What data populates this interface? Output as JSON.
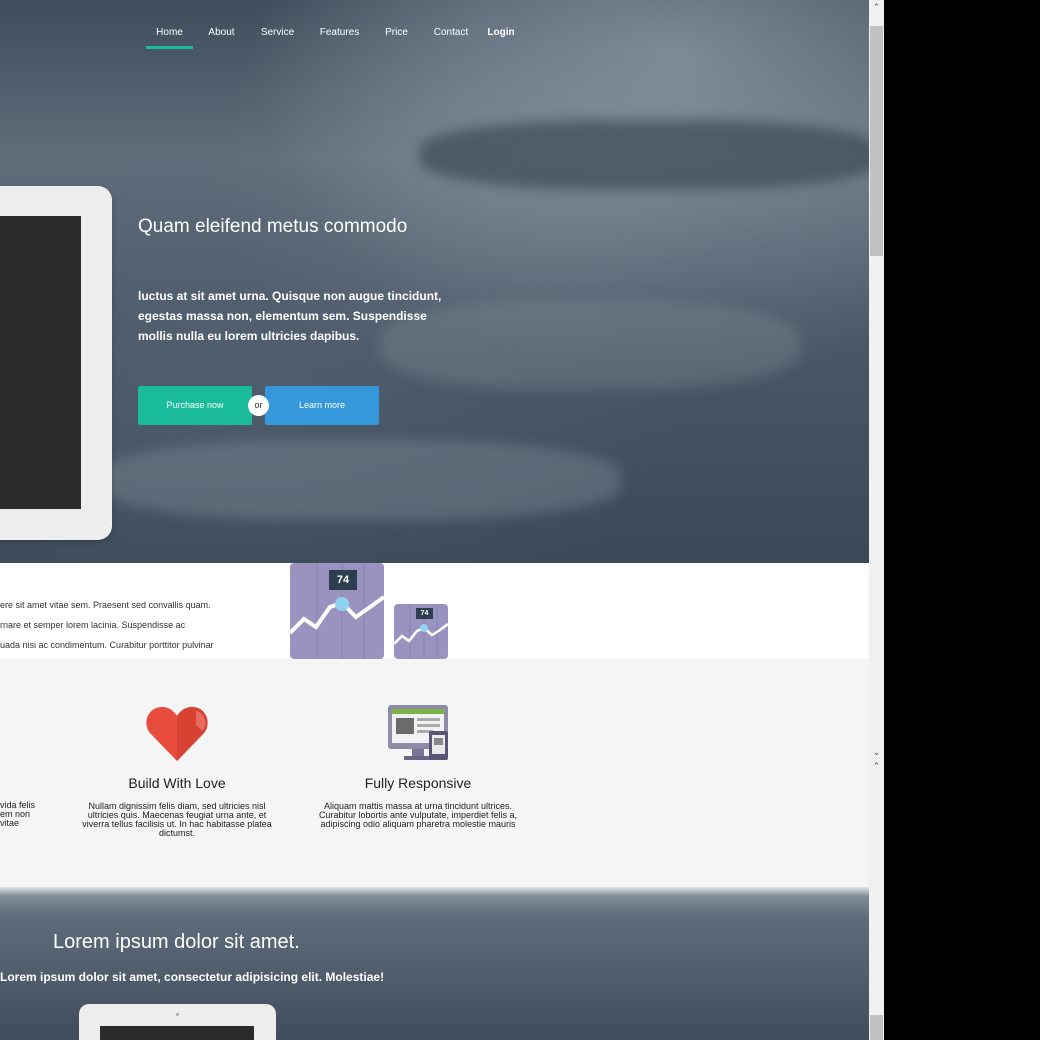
{
  "nav": {
    "items": [
      {
        "label": "Home",
        "active": true
      },
      {
        "label": "About",
        "active": false
      },
      {
        "label": "Service",
        "active": false
      },
      {
        "label": "Features",
        "active": false
      },
      {
        "label": "Price",
        "active": false
      },
      {
        "label": "Contact",
        "active": false
      }
    ],
    "login": "Login"
  },
  "hero": {
    "title": "Quam eleifend metus commodo",
    "text": "luctus at sit amet urna. Quisque non augue tincidunt, egestas massa non, elementum sem. Suspendisse mollis nulla eu lorem ultricies dapibus.",
    "purchase_label": "Purchase now",
    "or_label": "or",
    "learn_label": "Learn more"
  },
  "strip": {
    "lines": [
      "ere sit amet vitae sem. Praesent sed convallis quam.",
      "rnare et semper lorem lacinia. Suspendisse ac",
      "uada nisi ac condimentum. Curabitur porttitor pulvinar"
    ],
    "chart_badge_large": "74",
    "chart_badge_small": "74"
  },
  "features": {
    "left_fragment": [
      "vida felis",
      "em non",
      "vitae"
    ],
    "items": [
      {
        "icon": "heart-icon",
        "title": "Build With Love",
        "text": "Nullam dignissim felis diam, sed ultricies nisl ultricies quis. Maecenas feugiat urna ante, et viverra tellus facilisis ut. In hac habitasse platea dictumst."
      },
      {
        "icon": "responsive-devices-icon",
        "title": "Fully Responsive",
        "text": "Aliquam mattis massa at urna tincidunt ultrices. Curabitur lobortis ante vulputate, imperdiet felis a, adipiscing odio aliquam pharetra molestie mauris"
      }
    ]
  },
  "hero2": {
    "title": "Lorem ipsum dolor sit amet.",
    "subtitle": "Lorem ipsum dolor sit amet, consectetur adipisicing elit. Molestiae!"
  },
  "colors": {
    "accent_green": "#1abc9c",
    "accent_blue": "#3498db",
    "chart_purple": "#9b93bf",
    "heart_red": "#e74c3c"
  }
}
